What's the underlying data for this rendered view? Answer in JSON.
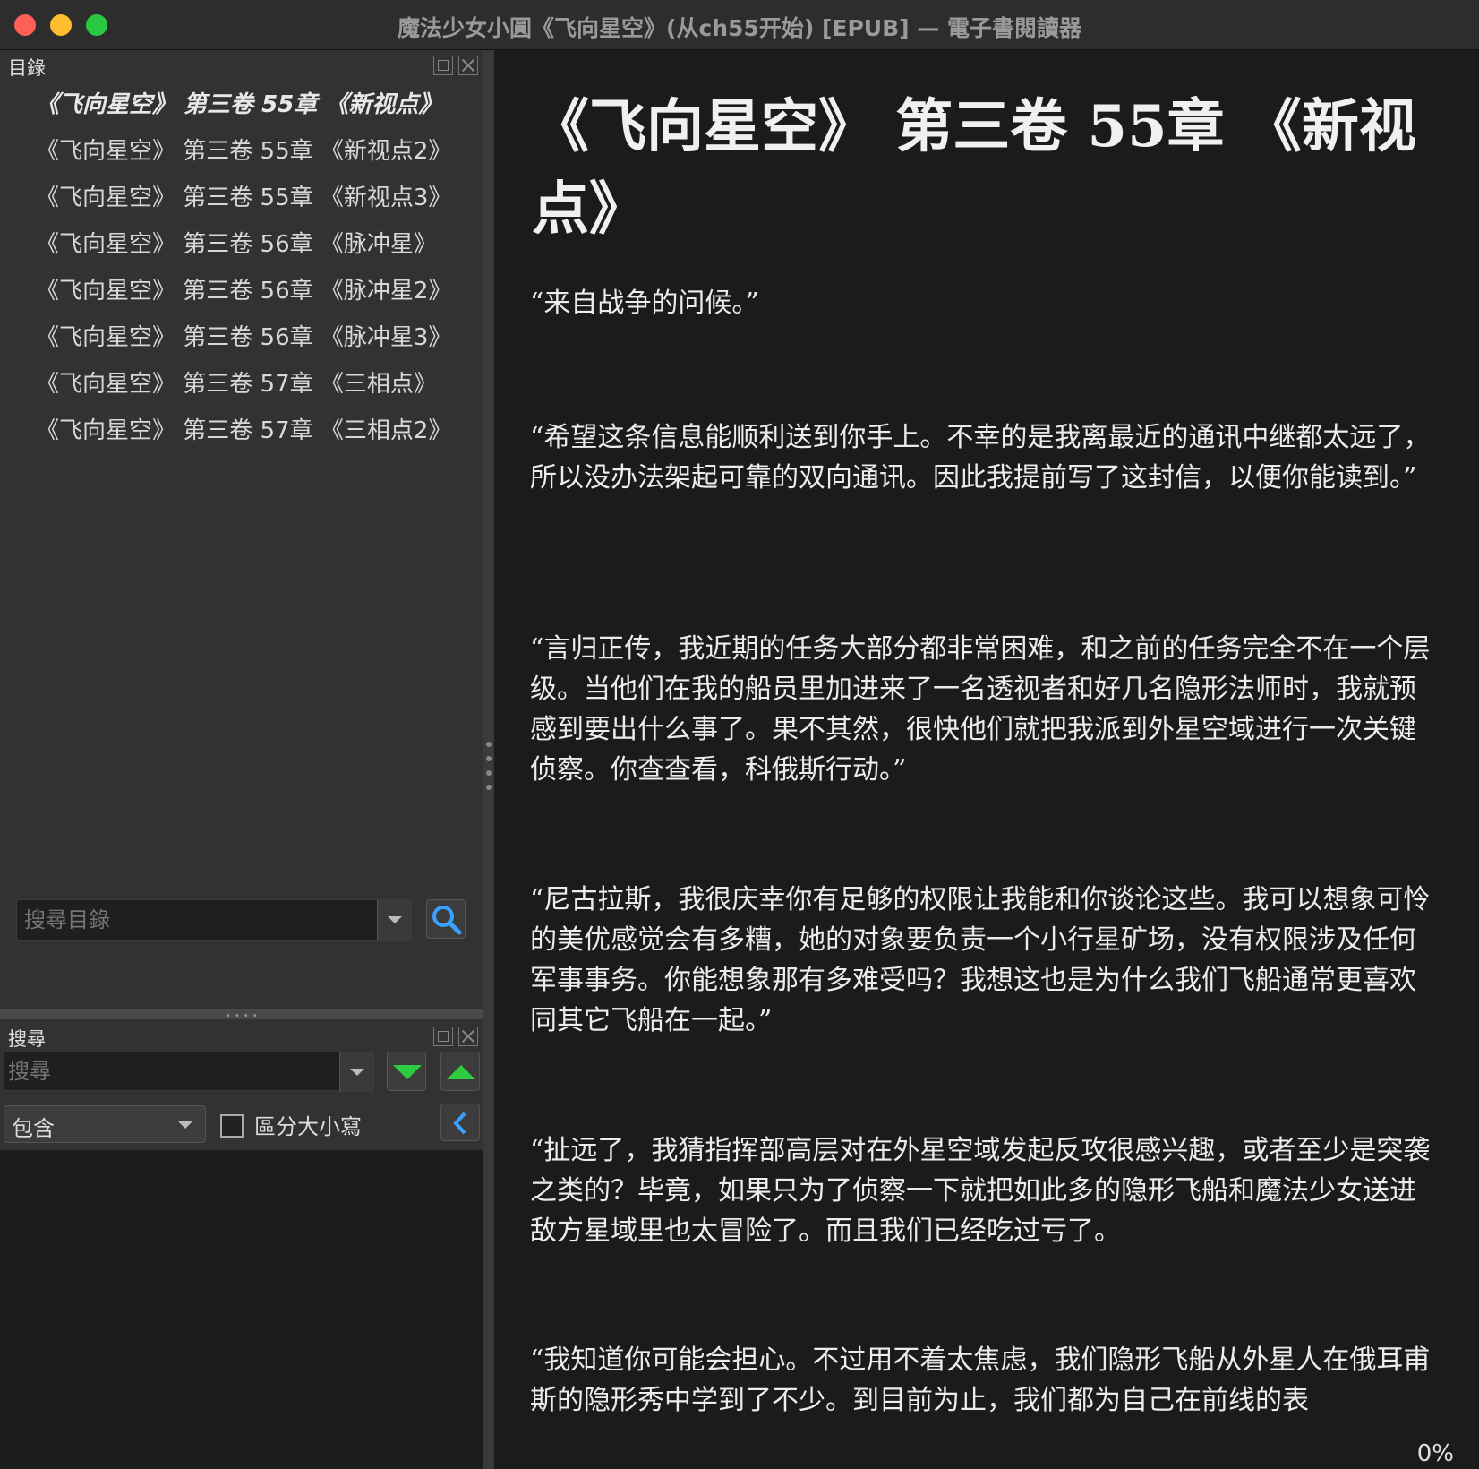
{
  "window": {
    "title": "魔法少女小圓《飞向星空》(从ch55开始) [EPUB] — 電子書閱讀器"
  },
  "toc": {
    "title": "目錄",
    "items": [
      {
        "label": "《飞向星空》 第三卷 55章 《新视点》",
        "active": true
      },
      {
        "label": "《飞向星空》 第三卷 55章 《新视点2》"
      },
      {
        "label": "《飞向星空》 第三卷 55章 《新视点3》"
      },
      {
        "label": "《飞向星空》 第三卷 56章 《脉冲星》"
      },
      {
        "label": "《飞向星空》 第三卷 56章 《脉冲星2》"
      },
      {
        "label": "《飞向星空》 第三卷 56章 《脉冲星3》"
      },
      {
        "label": "《飞向星空》 第三卷 57章 《三相点》"
      },
      {
        "label": "《飞向星空》 第三卷 57章 《三相点2》"
      }
    ],
    "search_placeholder": "搜尋目錄"
  },
  "search_panel": {
    "title": "搜尋",
    "placeholder": "搜尋",
    "mode": "包含",
    "case_label": "區分大小寫",
    "case_checked": false
  },
  "reader": {
    "chapter_title": "《飞向星空》 第三卷 55章 《新视点》",
    "paragraphs": [
      "“来自战争的问候。”",
      "“希望这条信息能顺利送到你手上。不幸的是我离最近的通讯中继都太远了，所以没办法架起可靠的双向通讯。因此我提前写了这封信，以便你能读到。”",
      "“言归正传，我近期的任务大部分都非常困难，和之前的任务完全不在一个层级。当他们在我的船员里加进来了一名透视者和好几名隐形法师时，我就预感到要出什么事了。果不其然，很快他们就把我派到外星空域进行一次关键侦察。你查查看，科俄斯行动。”",
      "“尼古拉斯，我很庆幸你有足够的权限让我能和你谈论这些。我可以想象可怜的美优感觉会有多糟，她的对象要负责一个小行星矿场，没有权限涉及任何军事事务。你能想象那有多难受吗？我想这也是为什么我们飞船通常更喜欢同其它飞船在一起。”",
      "“扯远了，我猜指挥部高层对在外星空域发起反攻很感兴趣，或者至少是突袭之类的？毕竟，如果只为了侦察一下就把如此多的隐形飞船和魔法少女送进敌方星域里也太冒险了。而且我们已经吃过亏了。",
      "“我知道你可能会担心。不过用不着太焦虑，我们隐形飞船从外星人在俄耳甫斯的隐形秀中学到了不少。到目前为止，我们都为自己在前线的表"
    ],
    "progress": "0%"
  }
}
